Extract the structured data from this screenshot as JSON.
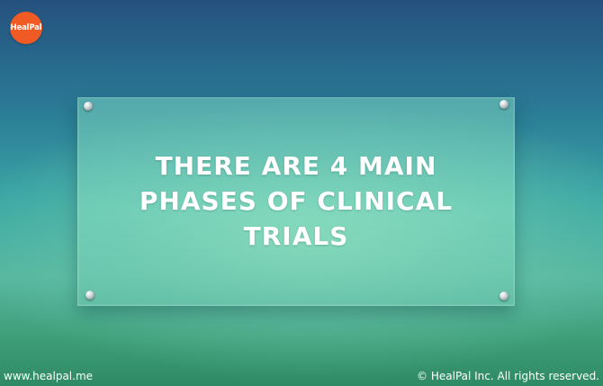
{
  "brand": {
    "logo_text": "HealPal",
    "logo_color": "#f05a24"
  },
  "panel": {
    "headline_lines": [
      "THERE ARE 4 MAIN",
      "PHASES OF CLINICAL",
      "TRIALS"
    ]
  },
  "footer": {
    "website": "www.healpal.me",
    "copyright": "© HealPal Inc. All rights reserved."
  }
}
